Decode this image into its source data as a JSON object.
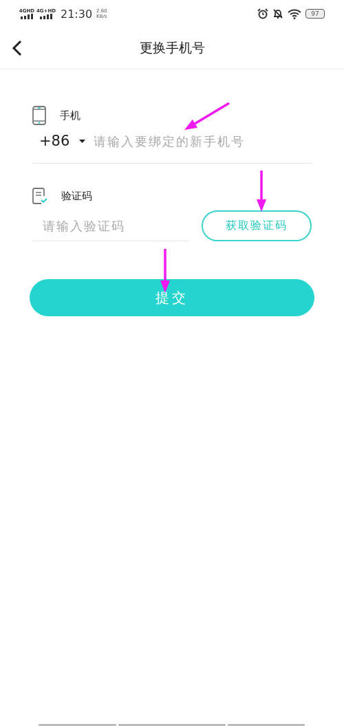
{
  "status_bar": {
    "signals": [
      "4GHD",
      "4G+HD"
    ],
    "time": "21:30",
    "speed": "2.60",
    "speed_unit": "KB/s",
    "battery": "97"
  },
  "header": {
    "title": "更换手机号"
  },
  "phone": {
    "label": "手机",
    "country_code": "+86",
    "placeholder": "请输入要绑定的新手机号"
  },
  "code": {
    "label": "验证码",
    "placeholder": "请输入验证码",
    "button": "获取验证码"
  },
  "submit": "提交"
}
